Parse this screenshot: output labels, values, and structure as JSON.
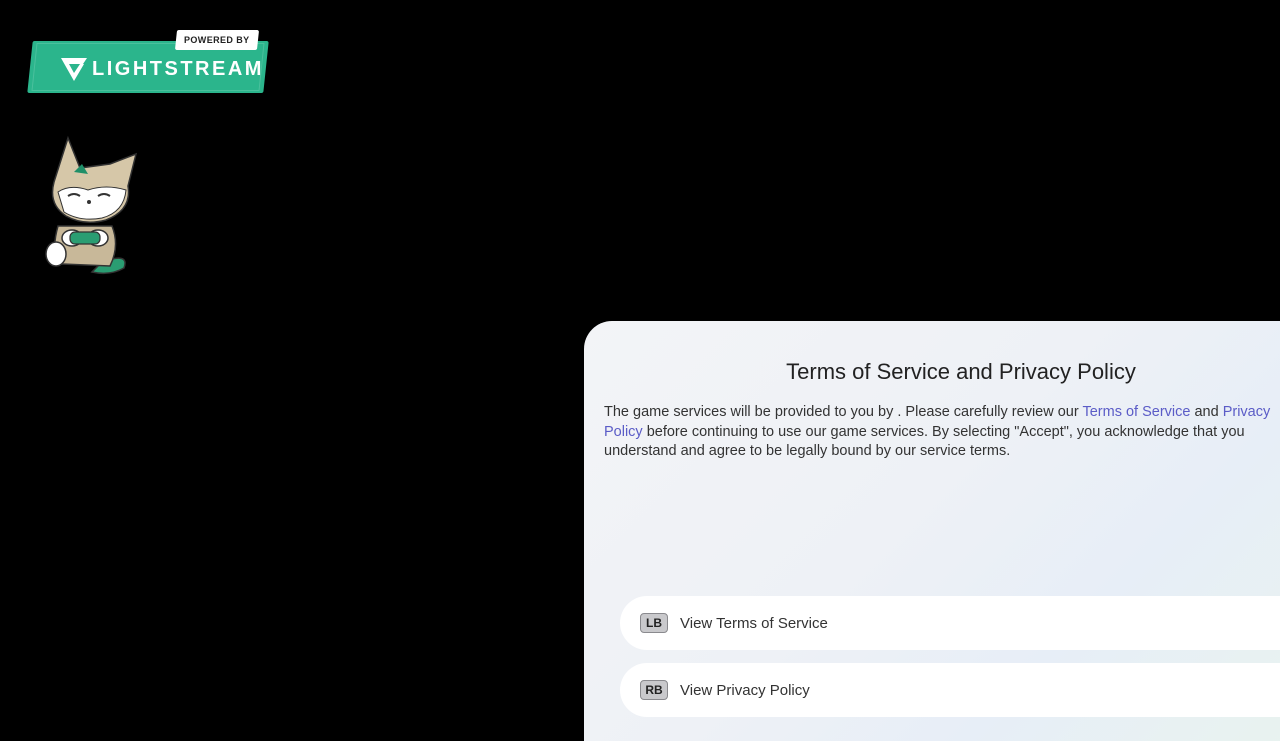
{
  "badge": {
    "powered_by": "POWERED BY",
    "brand": "LIGHTSTREAM",
    "color": "#2bb58c"
  },
  "mascot": {
    "icon": "fox-gamer-mascot-icon"
  },
  "dialog": {
    "title": "Terms of Service and Privacy Policy",
    "body_part1": "The game services will be provided to you by . Please carefully review our ",
    "tos_link": "Terms of Service",
    "body_part2": " and ",
    "privacy_link": "Privacy Policy",
    "body_part3": " before continuing to use our game services. By selecting \"Accept\", you acknowledge that you understand and agree to be legally bound by our service terms.",
    "link_color": "#5b5cc7",
    "options": [
      {
        "key": "LB",
        "label": "View Terms of Service"
      },
      {
        "key": "RB",
        "label": "View Privacy Policy"
      }
    ]
  }
}
